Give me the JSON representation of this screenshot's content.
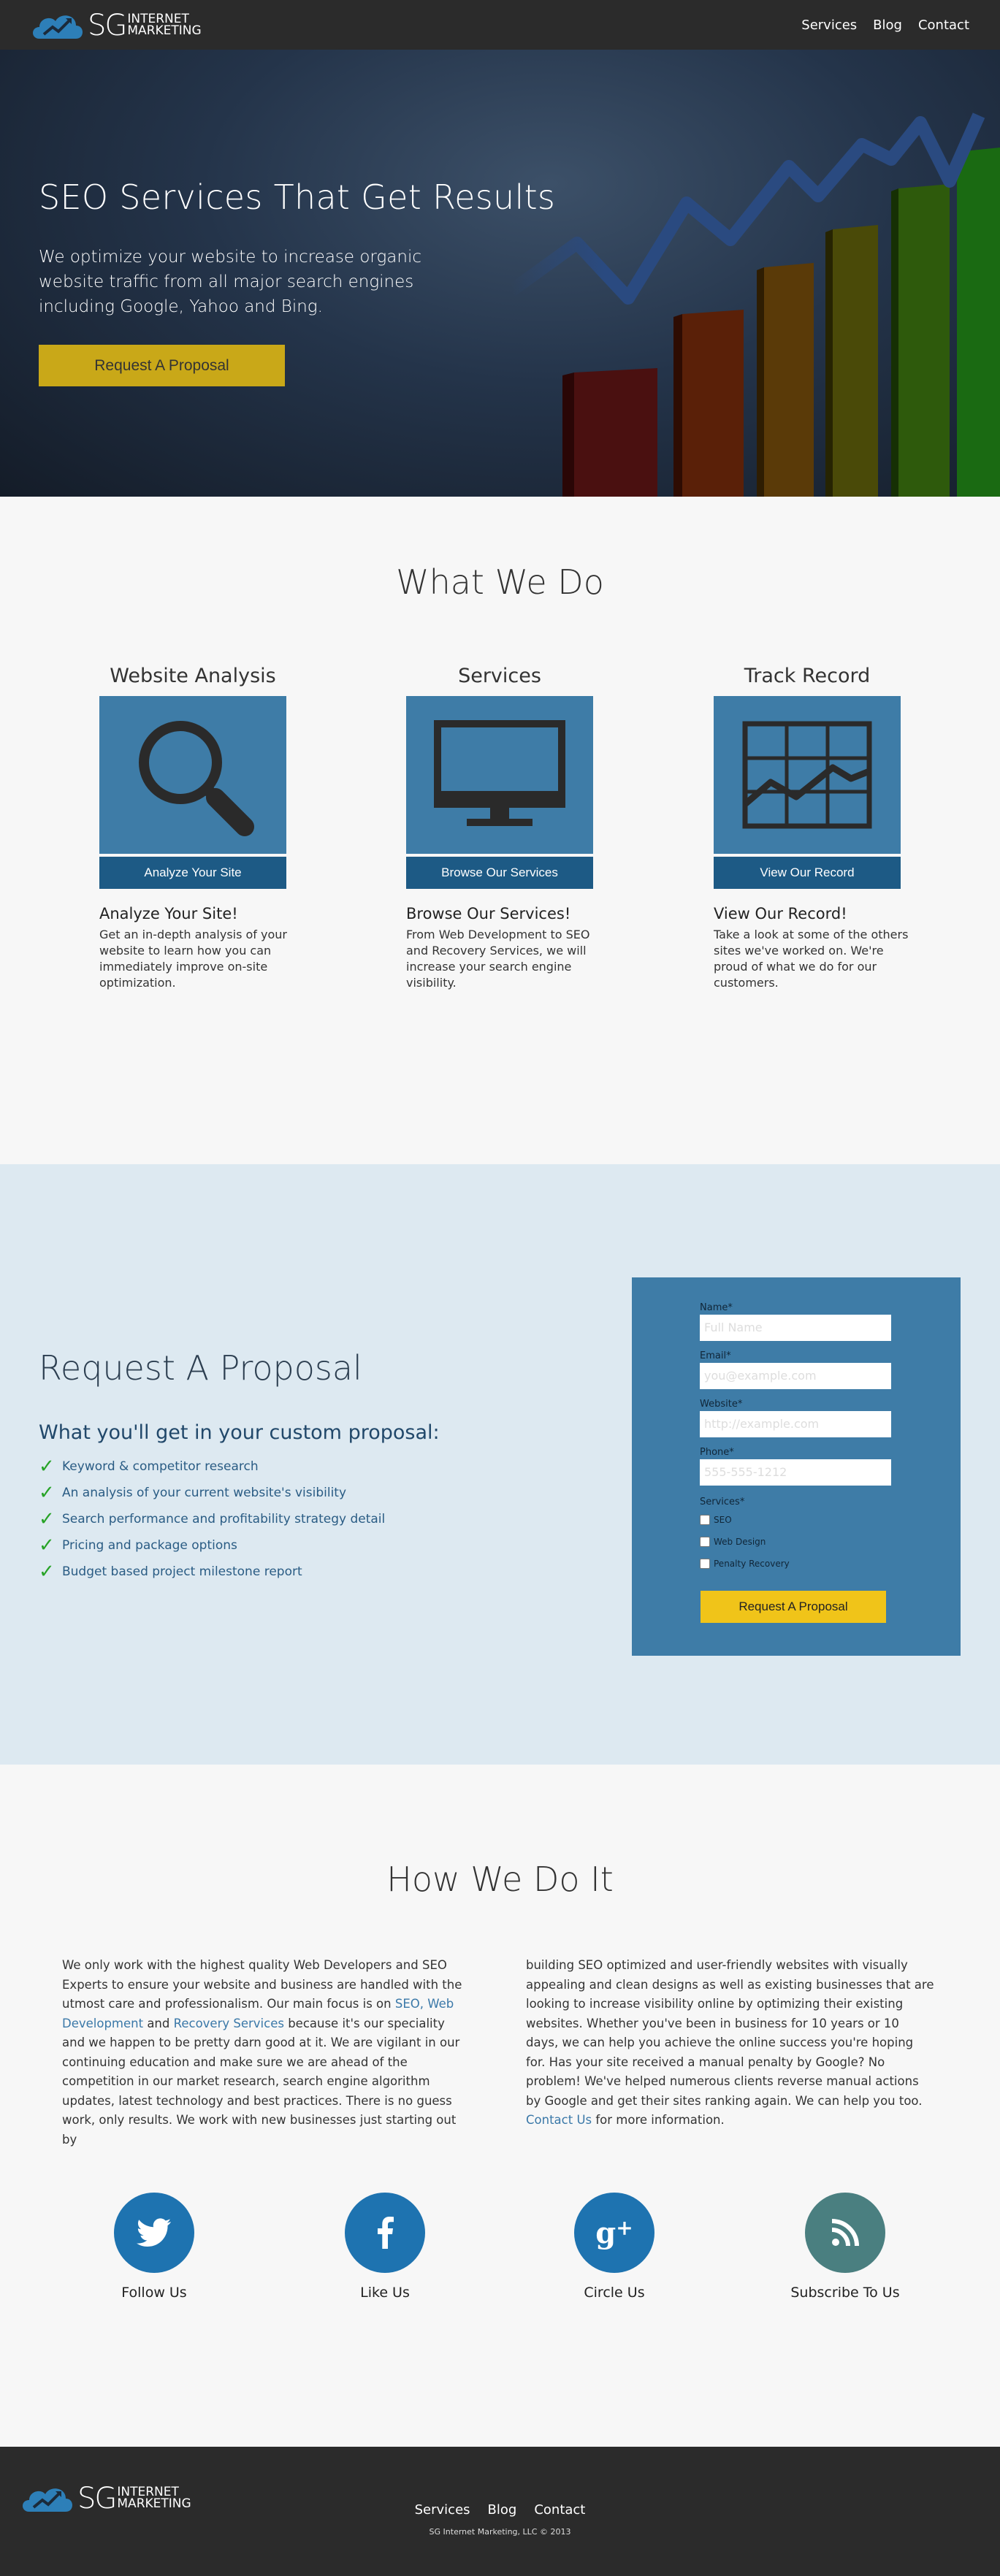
{
  "brand": {
    "sg": "SG",
    "line1": "INTERNET",
    "line2": "MARKETING"
  },
  "nav": {
    "items": [
      "Services",
      "Blog",
      "Contact"
    ]
  },
  "hero": {
    "title": "SEO Services That Get Results",
    "text": "We optimize your website to increase organic website traffic from all major search engines including Google, Yahoo and Bing.",
    "button": "Request A Proposal"
  },
  "what_we_do": {
    "title": "What We Do",
    "columns": [
      {
        "heading": "Website Analysis",
        "icon": "magnifier-icon",
        "button": "Analyze Your Site",
        "subheading": "Analyze Your Site!",
        "text": "Get an in-depth analysis of your website to learn how you can immediately improve on-site optimization."
      },
      {
        "heading": "Services",
        "icon": "monitor-icon",
        "button": "Browse Our Services",
        "subheading": "Browse Our Services!",
        "text": "From Web Development to SEO and Recovery Services, we will increase your search engine visibility."
      },
      {
        "heading": "Track Record",
        "icon": "chart-icon",
        "button": "View Our Record",
        "subheading": "View Our Record!",
        "text": "Take a look at some of the others sites we've worked on. We're proud of what we do for our customers."
      }
    ]
  },
  "proposal": {
    "title": "Request A Proposal",
    "subtitle": "What you'll get in your custom proposal:",
    "items": [
      "Keyword & competitor research",
      "An analysis of your current website's visibility",
      "Search performance and profitability strategy detail",
      "Pricing and package options",
      "Budget based project milestone report"
    ],
    "form": {
      "name_label": "Name*",
      "name_placeholder": "Full Name",
      "email_label": "Email*",
      "email_placeholder": "you@example.com",
      "website_label": "Website*",
      "website_placeholder": "http://example.com",
      "phone_label": "Phone*",
      "phone_placeholder": "555-555-1212",
      "services_label": "Services*",
      "services": [
        "SEO",
        "Web Design",
        "Penalty Recovery"
      ],
      "submit": "Request A Proposal"
    }
  },
  "how": {
    "title": "How We Do It",
    "left": {
      "p1": "We only work with the highest quality Web Developers and SEO Experts to ensure your website and business are handled with the utmost care and professionalism. Our main focus is on ",
      "link1": "SEO, Web Development",
      "p2": " and ",
      "link2": "Recovery Services",
      "p3": " because it's our speciality and we happen to be pretty darn good at it. We are vigilant in our continuing education and make sure we are ahead of the competition in our market research, search engine algorithm updates, latest technology and best practices. There is no guess work, only results. We work with new businesses just starting out by"
    },
    "right": {
      "p1": "building SEO optimized and user-friendly websites with visually appealing and clean designs as well as existing businesses that are looking to increase visibility online by optimizing their existing websites. Whether you've been in business for 10 years or 10 days, we can help you achieve the online success you're hoping for. Has your site received a manual penalty by Google? No problem! We've helped numerous clients reverse manual actions by Google and get their sites ranking again. We can help you too. ",
      "link": "Contact Us",
      "p2": " for more information."
    }
  },
  "social": [
    {
      "label": "Follow Us",
      "icon": "twitter-icon",
      "color": "#1e73b0"
    },
    {
      "label": "Like Us",
      "icon": "facebook-icon",
      "color": "#1e73b0"
    },
    {
      "label": "Circle Us",
      "icon": "google-plus-icon",
      "color": "#1e73b0"
    },
    {
      "label": "Subscribe To Us",
      "icon": "rss-icon",
      "color": "#4a7f80"
    }
  ],
  "footer": {
    "nav": [
      "Services",
      "Blog",
      "Contact"
    ],
    "copyright": "SG Internet Marketing, LLC © 2013"
  },
  "colors": {
    "header": "#2b2b2b",
    "accent_yellow": "#c9a818",
    "panel_blue": "#3e7ca7",
    "button_blue": "#1d5a85",
    "proposal_bg": "#dde9f1"
  }
}
